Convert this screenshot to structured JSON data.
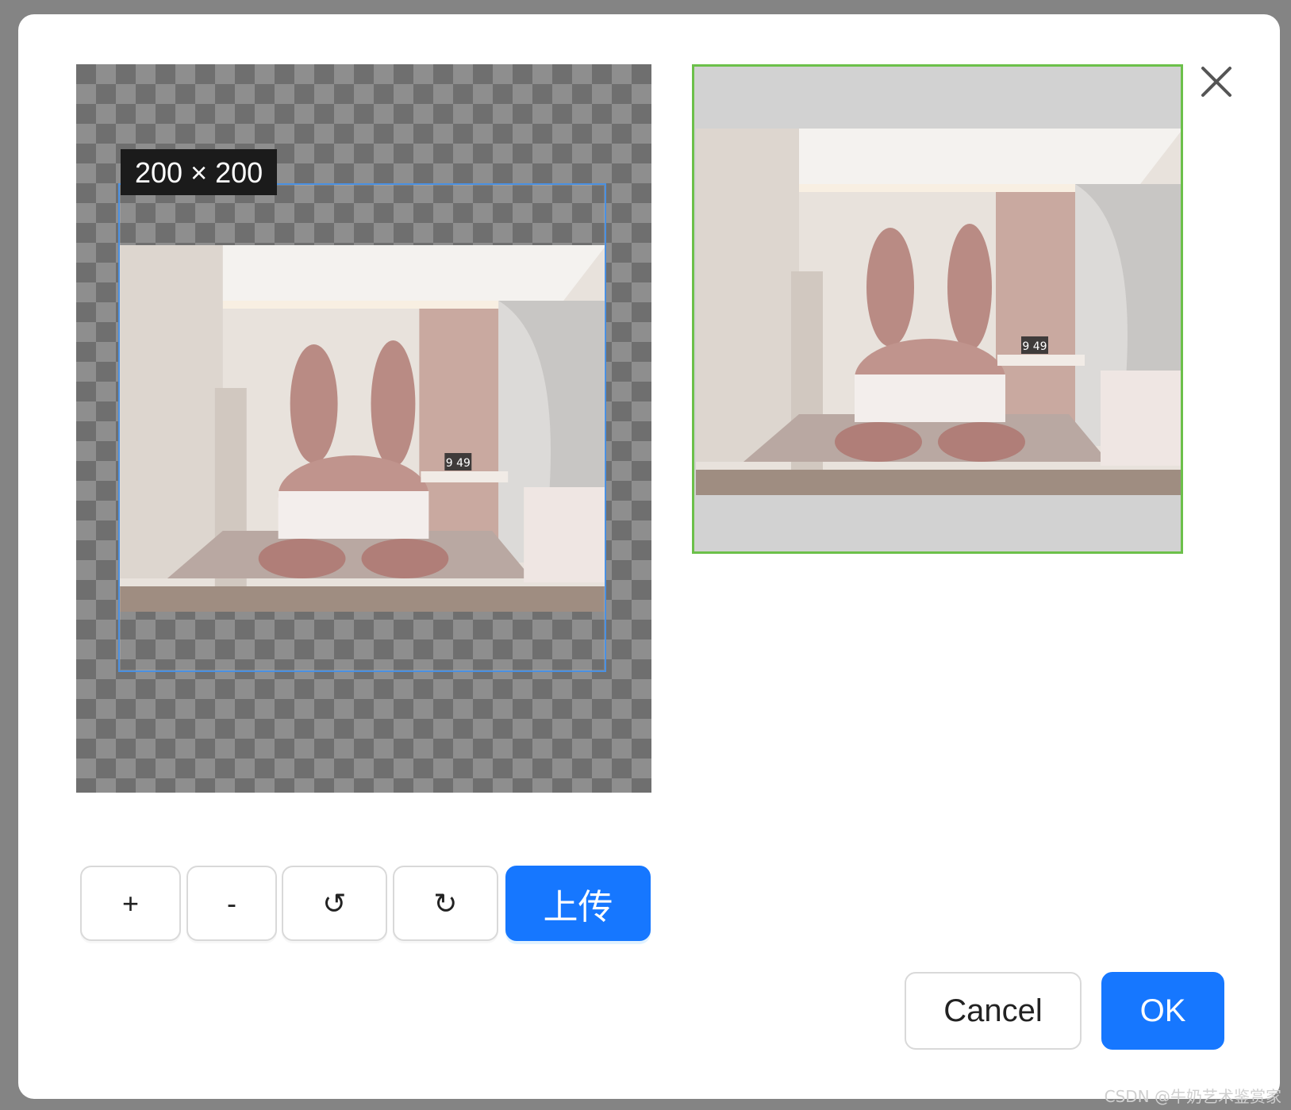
{
  "cropper": {
    "size_label": "200 × 200"
  },
  "toolbar": {
    "zoom_in_label": "+",
    "zoom_out_label": "-",
    "rotate_left_label": "↺",
    "rotate_right_label": "↻",
    "upload_label": "上传"
  },
  "footer": {
    "cancel_label": "Cancel",
    "ok_label": "OK"
  },
  "clock_text": "9 49",
  "watermark": "CSDN @牛奶艺术鉴赏家",
  "colors": {
    "primary": "#1677ff",
    "crop_border": "#4a90e2",
    "preview_border": "#6cc04a"
  }
}
